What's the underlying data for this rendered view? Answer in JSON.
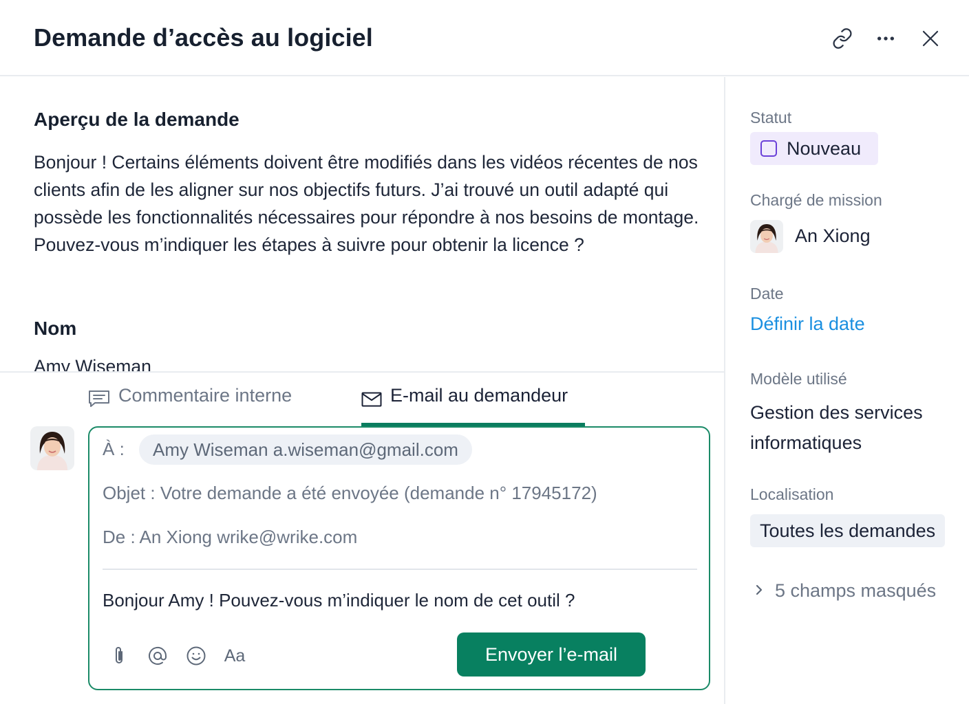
{
  "header": {
    "title": "Demande d’accès au logiciel",
    "icons": [
      "link-icon",
      "more-icon",
      "close-icon"
    ]
  },
  "main": {
    "overview_title": "Aperçu de la demande",
    "overview_text": "Bonjour ! Certains éléments doivent être modifiés dans les vidéos récentes de nos clients afin de les aligner sur nos objectifs futurs. J’ai trouvé un outil adapté qui possède les fonctionnalités nécessaires pour répondre à nos besoins de montage. Pouvez-vous m’indiquer les étapes à suivre pour obtenir la licence ?",
    "name_title": "Nom",
    "name_value": "Amy Wiseman"
  },
  "tabs": [
    {
      "label": "Commentaire interne",
      "icon": "comment-icon",
      "active": false
    },
    {
      "label": "E-mail au demandeur",
      "icon": "mail-icon",
      "active": true
    }
  ],
  "composer": {
    "to_label": "À :",
    "to_recipient": "Amy Wiseman a.wiseman@gmail.com",
    "subject": "Objet : Votre demande a été envoyée (demande n° 17945172)",
    "from": "De : An Xiong wrike@wrike.com",
    "body": "Bonjour Amy ! Pouvez-vous m’indiquer le nom de cet outil ?",
    "tools": [
      "paperclip-icon",
      "at-icon",
      "emoji-icon",
      "text-format-icon"
    ],
    "format_label": "Aa",
    "send_label": "Envoyer l’e-mail"
  },
  "sidebar": {
    "status_label": "Statut",
    "status_value": "Nouveau",
    "assignee_label": "Chargé de mission",
    "assignee_name": "An Xiong",
    "date_label": "Date",
    "date_link": "Définir la date",
    "template_label": "Modèle utilisé",
    "template_value": "Gestion des services informatiques",
    "location_label": "Localisation",
    "location_value": "Toutes les demandes",
    "hidden_fields": "5 champs masqués"
  },
  "colors": {
    "accent_green": "#088060",
    "status_purple": "#6a40d8",
    "link_blue": "#1a8fe0",
    "muted_text": "#6c7686"
  }
}
